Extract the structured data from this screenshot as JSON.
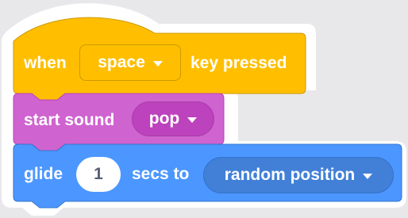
{
  "colors": {
    "event": "#ffbf00",
    "event_border": "#cc9900",
    "sound": "#cf63cf",
    "sound_border": "#bd42bd",
    "sound_dropdown": "#bd42bd",
    "motion": "#4c97ff",
    "motion_border": "#3373cc",
    "motion_dropdown": "#4280d7",
    "background": "#e8e8ea"
  },
  "blocks": {
    "event": {
      "prefix": "when",
      "key_option": "space",
      "suffix": "key pressed"
    },
    "sound": {
      "prefix": "start sound",
      "sound_option": "pop"
    },
    "motion": {
      "prefix": "glide",
      "seconds": "1",
      "middle": "secs to",
      "target_option": "random position"
    }
  }
}
